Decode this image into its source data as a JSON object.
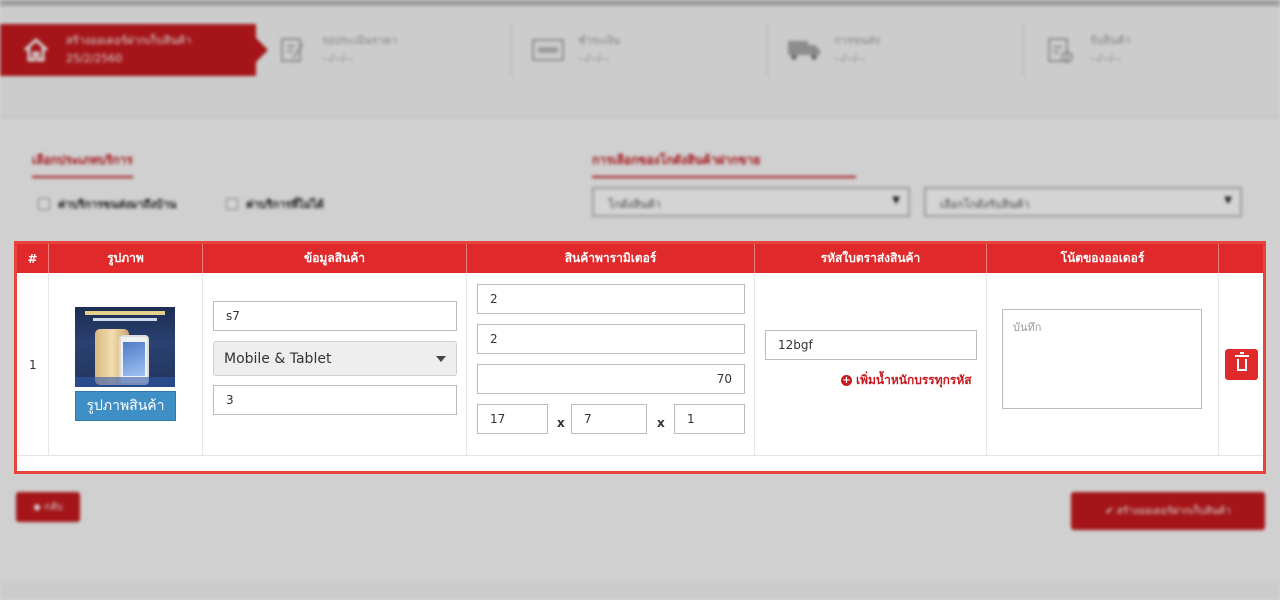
{
  "steps": [
    {
      "title": "สร้างออเดอร์ฝากเก็บสินค้า",
      "date": "25/2/2560",
      "icon": "home-icon"
    },
    {
      "title": "รอประเมินราคา",
      "date": "--/--/--",
      "icon": "edit-icon"
    },
    {
      "title": "ชำระเงิน",
      "date": "--/--/--",
      "icon": "visa-card-icon"
    },
    {
      "title": "การขนส่ง",
      "date": "--/--/--",
      "icon": "truck-icon"
    },
    {
      "title": "รับสินค้า",
      "date": "--/--/--",
      "icon": "checklist-icon"
    }
  ],
  "background": {
    "service_title": "เลือกประเภทบริการ",
    "service_options": [
      "ค่าบริการขนส่งมาถึงบ้าน",
      "ค่าบริการที่ไม่ได้"
    ],
    "warehouse_title": "การเลือกของโกดังสินค้าฝากขาย",
    "warehouse_select": "โกดังสินค้า",
    "category_select": "เลือกโกดังรับสินค้า",
    "back_label": "กลับ",
    "create_label": "สร้างออเดอร์ฝากเก็บสินค้า"
  },
  "table": {
    "headers": [
      "#",
      "รูปภาพ",
      "ข้อมูลสินค้า",
      "สินค้าพารามิเตอร์",
      "รหัสใบตราส่งสินค้า",
      "โน้ตของออเดอร์",
      ""
    ],
    "row": {
      "number": "1",
      "image_button": "รูปภาพสินค้า",
      "product_name": "s7",
      "category": "Mobile & Tablet",
      "quantity": "3",
      "param1": "2",
      "param2": "2",
      "weight": "70",
      "dim_w": "17",
      "dim_l": "7",
      "dim_h": "1",
      "dim_sep": "x",
      "tracking_code": "12bgf",
      "add_weight_link": "เพิ่มน้ำหนักบรรทุกรหัส",
      "note_placeholder": "บันทึก"
    }
  },
  "colors": {
    "brand_red": "#e0292b",
    "image_button": "#3e8fc5"
  }
}
